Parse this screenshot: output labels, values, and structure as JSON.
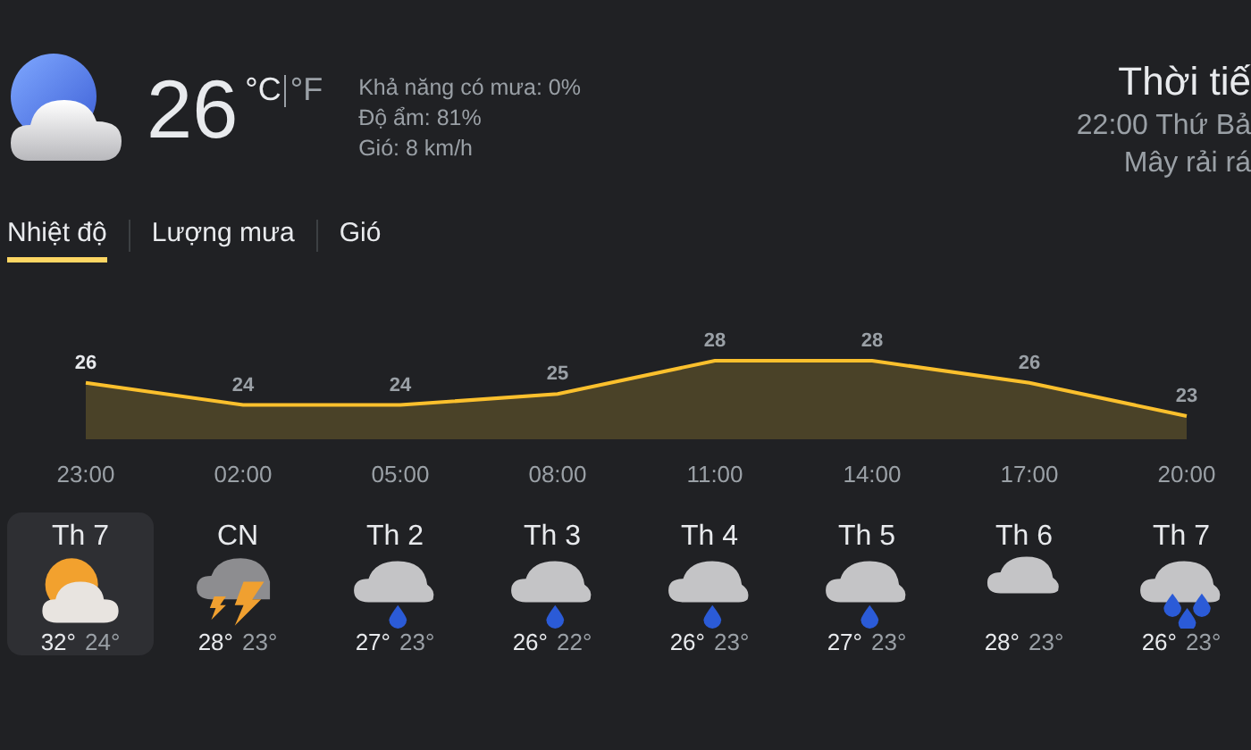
{
  "current": {
    "temperature": "26",
    "units": [
      {
        "label": "°C",
        "selected": true
      },
      {
        "label": "°F",
        "selected": false
      }
    ],
    "details": [
      "Khả năng có mưa: 0%",
      "Độ ẩm: 81%",
      "Gió: 8 km/h"
    ]
  },
  "location": {
    "title": "Thời tiế",
    "time": "22:00 Thứ Bả",
    "condition": "Mây rải rá"
  },
  "tabs": [
    {
      "label": "Nhiệt độ",
      "selected": true
    },
    {
      "label": "Lượng mưa",
      "selected": false
    },
    {
      "label": "Gió",
      "selected": false
    }
  ],
  "chart_data": {
    "type": "area",
    "categories": [
      "23:00",
      "02:00",
      "05:00",
      "08:00",
      "11:00",
      "14:00",
      "17:00",
      "20:00"
    ],
    "series": [
      {
        "color": "#fbc02d",
        "values": [
          26,
          24,
          24,
          25,
          28,
          28,
          26,
          23
        ]
      }
    ],
    "data_labels": true
  },
  "days": [
    {
      "day": "Th 7",
      "kind": "sun-cloud",
      "high": "32°",
      "low": "24°",
      "selected": true
    },
    {
      "day": "CN",
      "kind": "thunder",
      "high": "28°",
      "low": "23°",
      "selected": false
    },
    {
      "day": "Th 2",
      "kind": "rain",
      "high": "27°",
      "low": "23°",
      "selected": false
    },
    {
      "day": "Th 3",
      "kind": "rain",
      "high": "26°",
      "low": "22°",
      "selected": false
    },
    {
      "day": "Th 4",
      "kind": "rain",
      "high": "26°",
      "low": "23°",
      "selected": false
    },
    {
      "day": "Th 5",
      "kind": "rain",
      "high": "27°",
      "low": "23°",
      "selected": false
    },
    {
      "day": "Th 6",
      "kind": "cloud",
      "high": "28°",
      "low": "23°",
      "selected": false
    },
    {
      "day": "Th 7",
      "kind": "heavy-rain",
      "high": "26°",
      "low": "23°",
      "selected": false
    }
  ]
}
